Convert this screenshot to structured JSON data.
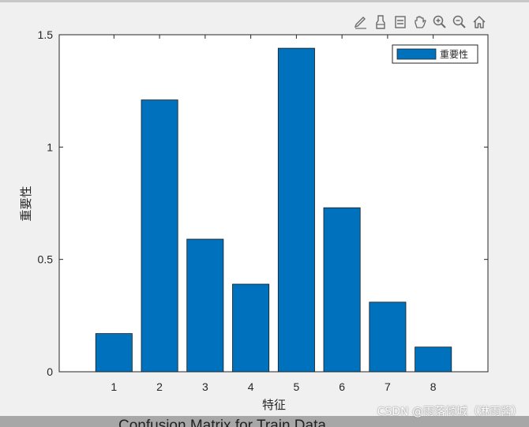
{
  "chart_data": {
    "type": "bar",
    "categories": [
      "1",
      "2",
      "3",
      "4",
      "5",
      "6",
      "7",
      "8"
    ],
    "series": [
      {
        "name": "重要性",
        "values": [
          0.17,
          1.21,
          0.59,
          0.39,
          1.44,
          0.73,
          0.31,
          0.11
        ]
      }
    ],
    "xlabel": "特征",
    "ylabel": "重要性",
    "ylim": [
      0,
      1.5
    ],
    "yticks": [
      "0",
      "0.5",
      "1",
      "1.5"
    ],
    "legend": "top-right",
    "grid": false,
    "bar_color": "#0072bd"
  },
  "toolbar": {
    "icons": [
      "edit-icon",
      "brush-icon",
      "legend-icon",
      "pan-icon",
      "zoom-in-icon",
      "zoom-out-icon",
      "home-icon"
    ]
  },
  "bottom_title": "Confusion Matrix for Train Data",
  "watermark": "CSDN @雨落倾城（淋雨酱）"
}
